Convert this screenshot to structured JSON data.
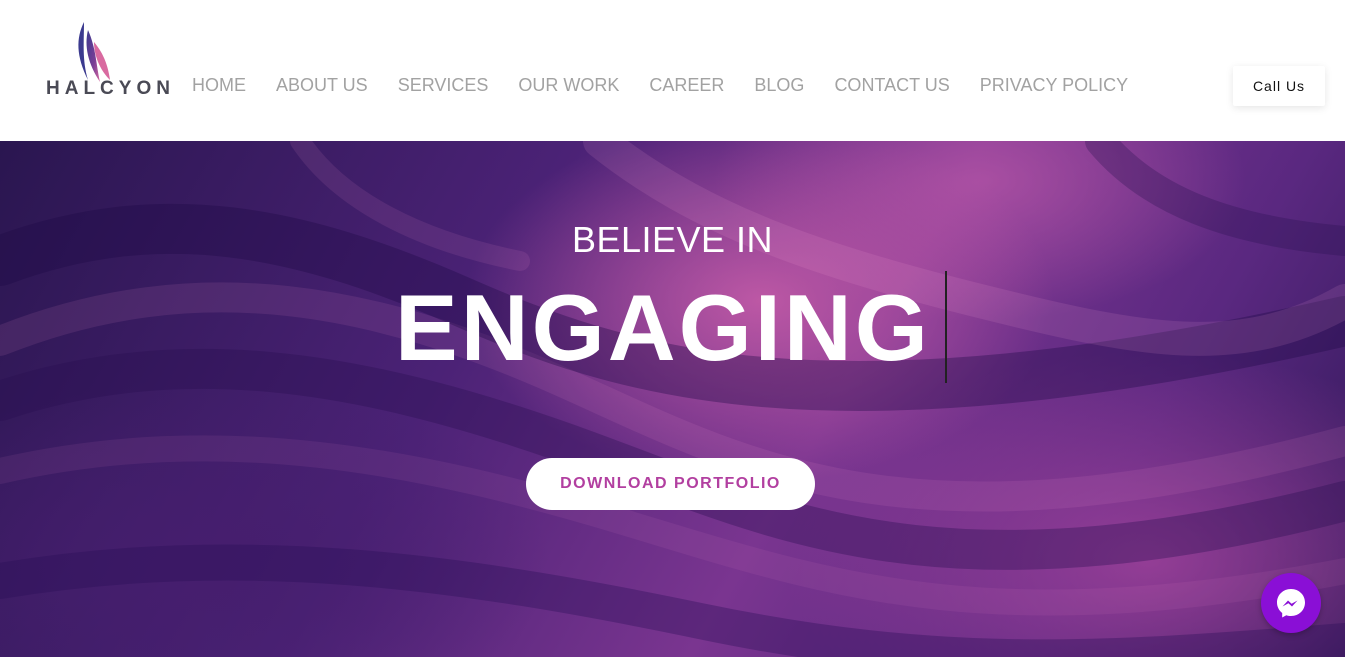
{
  "brand": {
    "name": "HALCYON"
  },
  "nav": {
    "items": [
      {
        "label": "HOME"
      },
      {
        "label": "ABOUT US"
      },
      {
        "label": "SERVICES"
      },
      {
        "label": "OUR WORK"
      },
      {
        "label": "CAREER"
      },
      {
        "label": "BLOG"
      },
      {
        "label": "CONTACT US"
      },
      {
        "label": "PRIVACY POLICY"
      }
    ]
  },
  "header": {
    "call_label": "Call Us"
  },
  "hero": {
    "kicker": "BELIEVE IN",
    "headline": "ENGAGING",
    "cta_label": "DOWNLOAD PORTFOLIO"
  },
  "icons": {
    "logo": "feather-logo-icon",
    "chat": "messenger-icon"
  },
  "colors": {
    "nav_text": "#a2a2a2",
    "cta_text": "#b23fa0",
    "messenger_bg": "#8a0fd6",
    "hero_dark": "#2a1650",
    "hero_pink": "#cb5faa"
  }
}
